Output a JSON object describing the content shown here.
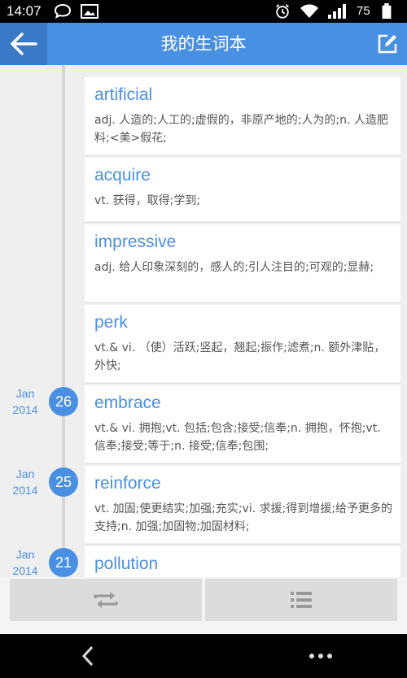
{
  "status_bar": {
    "time": "14:07",
    "battery": "75"
  },
  "app_bar": {
    "title": "我的生词本",
    "back_icon": "back-arrow-icon",
    "edit_icon": "edit-icon"
  },
  "words": [
    {
      "word": "artificial",
      "definition": "adj. 人造的;人工的;虚假的，非原产地的;人为的;n. 人造肥料;<美>假花;"
    },
    {
      "word": "acquire",
      "definition": "vt. 获得，取得;学到;"
    },
    {
      "word": "impressive",
      "definition": "adj. 给人印象深刻的，感人的;引人注目的;可观的;显赫;"
    },
    {
      "word": "perk",
      "definition": "vt.& vi. （使）活跃;竖起，翘起;振作;滤煮;n. 额外津贴，外快;"
    },
    {
      "word": "embrace",
      "definition": "vt.& vi. 拥抱;vt. 包括;包含;接受;信奉;n. 拥抱，怀抱;vt. 信奉;接受;等于;n. 接受;信奉;包围;",
      "date": {
        "month": "Jan",
        "year": "2014",
        "day": "26"
      }
    },
    {
      "word": "reinforce",
      "definition": "vt. 加固;使更结实;加强;充实;vi. 求援;得到增援;给予更多的支持;n. 加强;加固物;加固材料;",
      "date": {
        "month": "Jan",
        "year": "2014",
        "day": "25"
      }
    },
    {
      "word": "pollution",
      "definition": "",
      "date": {
        "month": "Jan",
        "year": "2014",
        "day": "21"
      }
    }
  ],
  "toolbar": {
    "left_icon": "shuffle-icon",
    "right_icon": "list-icon"
  },
  "colors": {
    "accent": "#4a90e2",
    "accent_dark": "#3a79c7"
  }
}
